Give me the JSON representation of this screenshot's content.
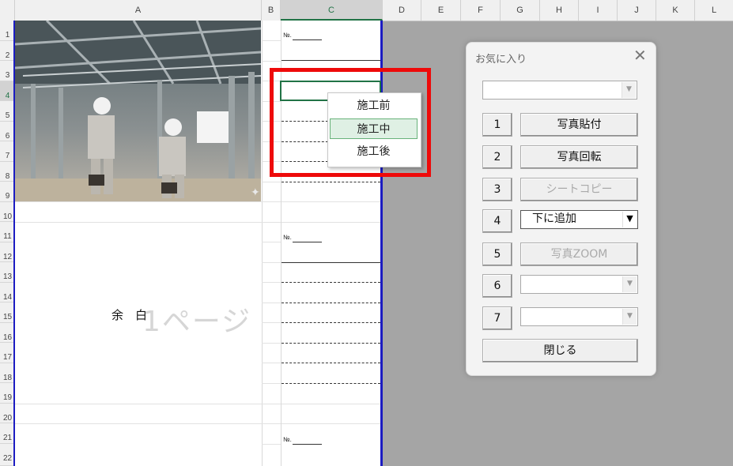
{
  "spreadsheet": {
    "columns": [
      "A",
      "B",
      "C",
      "D",
      "E",
      "F",
      "G",
      "H",
      "I",
      "J",
      "K",
      "L"
    ],
    "rows": [
      "1",
      "2",
      "3",
      "4",
      "5",
      "6",
      "7",
      "8",
      "9",
      "10",
      "11",
      "12",
      "13",
      "14",
      "15",
      "16",
      "17",
      "18",
      "19",
      "20",
      "21",
      "22"
    ],
    "no_label": "№.",
    "yohaku": "余　白",
    "page_watermark": "1ページ"
  },
  "context_menu": {
    "items": [
      {
        "label": "施工前",
        "highlighted": false
      },
      {
        "label": "施工中",
        "highlighted": true
      },
      {
        "label": "施工後",
        "highlighted": false
      }
    ],
    "highlight_color": "#dff0e4",
    "frame_color": "#ee0a0a"
  },
  "dialog": {
    "title": "お気に入り",
    "close_icon": "close-icon",
    "top_combo_value": "",
    "rows": [
      {
        "num": "1",
        "action": "写真貼付",
        "kind": "button",
        "enabled": true
      },
      {
        "num": "2",
        "action": "写真回転",
        "kind": "button",
        "enabled": true
      },
      {
        "num": "3",
        "action": "シートコピー",
        "kind": "button",
        "enabled": false
      },
      {
        "num": "4",
        "action": "下に追加",
        "kind": "combo",
        "enabled": true
      },
      {
        "num": "5",
        "action": "写真ZOOM",
        "kind": "button",
        "enabled": false
      },
      {
        "num": "6",
        "action": "",
        "kind": "combo",
        "enabled": false
      },
      {
        "num": "7",
        "action": "",
        "kind": "combo",
        "enabled": false
      }
    ],
    "close_button": "閉じる"
  }
}
